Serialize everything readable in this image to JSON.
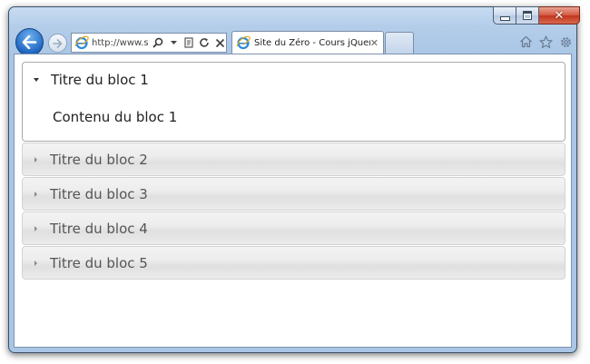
{
  "window": {
    "close_glyph": "✕"
  },
  "toolbar": {
    "back_icon": "back-arrow-icon",
    "forward_icon": "forward-arrow-icon"
  },
  "address_bar": {
    "url": "http://www.s..."
  },
  "tabs": [
    {
      "title": "Site du Zéro - Cours jQuery",
      "close": "✕"
    }
  ],
  "accordion": {
    "open_item": {
      "title": "Titre du bloc 1",
      "content": "Contenu du bloc 1"
    },
    "collapsed_items": [
      {
        "title": "Titre du bloc 2"
      },
      {
        "title": "Titre du bloc 3"
      },
      {
        "title": "Titre du bloc 4"
      },
      {
        "title": "Titre du bloc 5"
      }
    ]
  },
  "colors": {
    "frame": "#a9c6e6",
    "back_button": "#1f66c2",
    "close_button": "#c2351c"
  }
}
